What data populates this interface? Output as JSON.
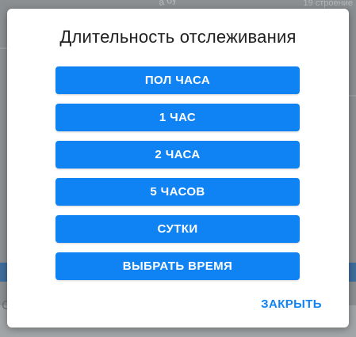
{
  "background": {
    "street_label": "а бу",
    "address_label": "19 строение",
    "bottom_partial_text": "С"
  },
  "dialog": {
    "title": "Длительность отслеживания",
    "options": [
      {
        "label": "ПОЛ ЧАСА"
      },
      {
        "label": "1 ЧАС"
      },
      {
        "label": "2 ЧАСА"
      },
      {
        "label": "5 ЧАСОВ"
      },
      {
        "label": "СУТКИ"
      },
      {
        "label": "ВЫБРАТЬ ВРЕМЯ"
      }
    ],
    "close_label": "ЗАКРЫТЬ"
  },
  "colors": {
    "accent": "#1083f4",
    "dialog_background": "#ffffff",
    "overlay": "#8c8f91",
    "title_text": "#212121"
  }
}
